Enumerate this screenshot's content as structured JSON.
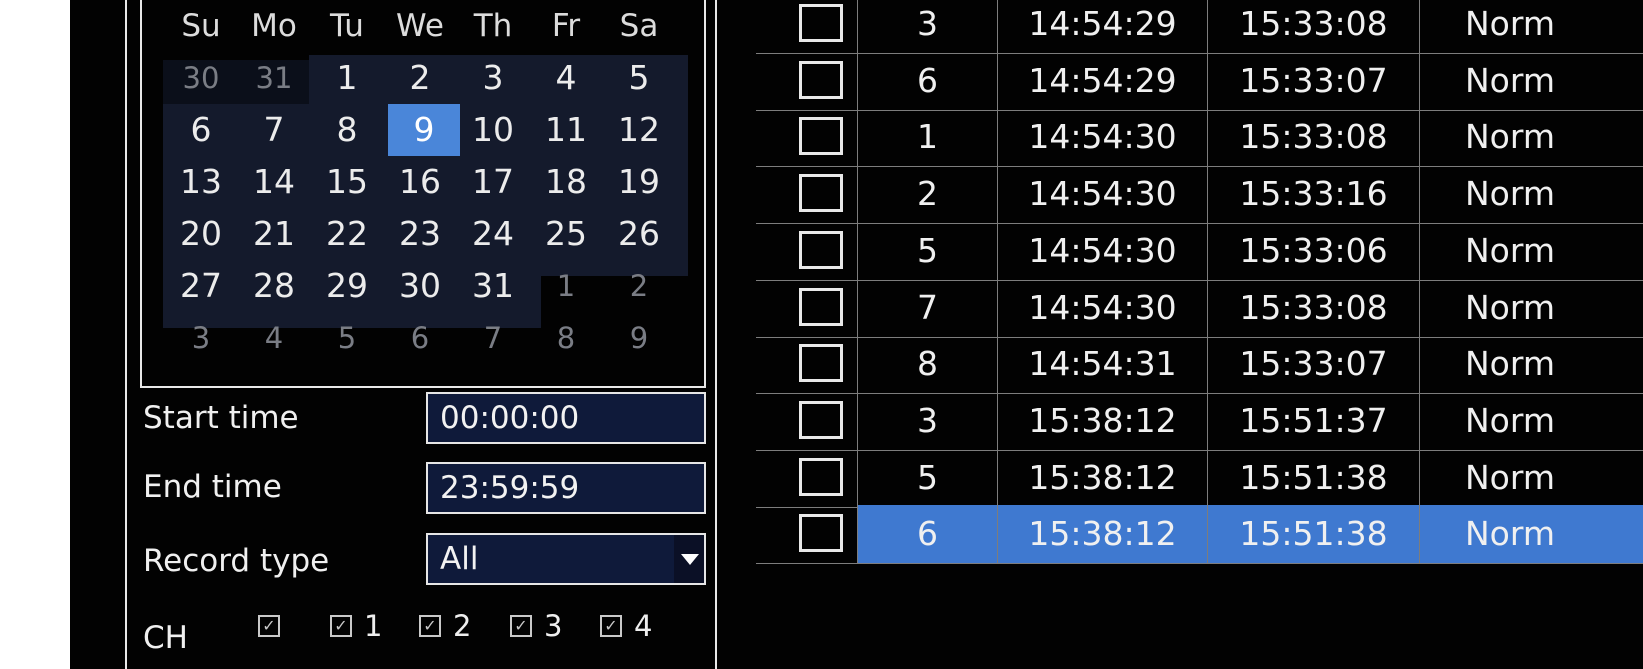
{
  "calendar": {
    "weekdays": [
      "Su",
      "Mo",
      "Tu",
      "We",
      "Th",
      "Fr",
      "Sa"
    ],
    "weeks": [
      [
        {
          "d": "30",
          "m": true
        },
        {
          "d": "31",
          "m": true
        },
        {
          "d": "1"
        },
        {
          "d": "2"
        },
        {
          "d": "3"
        },
        {
          "d": "4"
        },
        {
          "d": "5"
        }
      ],
      [
        {
          "d": "6"
        },
        {
          "d": "7"
        },
        {
          "d": "8"
        },
        {
          "d": "9",
          "sel": true
        },
        {
          "d": "10"
        },
        {
          "d": "11"
        },
        {
          "d": "12"
        }
      ],
      [
        {
          "d": "13"
        },
        {
          "d": "14"
        },
        {
          "d": "15"
        },
        {
          "d": "16"
        },
        {
          "d": "17"
        },
        {
          "d": "18"
        },
        {
          "d": "19"
        }
      ],
      [
        {
          "d": "20"
        },
        {
          "d": "21"
        },
        {
          "d": "22"
        },
        {
          "d": "23"
        },
        {
          "d": "24"
        },
        {
          "d": "25"
        },
        {
          "d": "26"
        }
      ],
      [
        {
          "d": "27"
        },
        {
          "d": "28"
        },
        {
          "d": "29"
        },
        {
          "d": "30"
        },
        {
          "d": "31"
        },
        {
          "d": "1",
          "m": true
        },
        {
          "d": "2",
          "m": true
        }
      ],
      [
        {
          "d": "3",
          "m": true
        },
        {
          "d": "4",
          "m": true
        },
        {
          "d": "5",
          "m": true
        },
        {
          "d": "6",
          "m": true
        },
        {
          "d": "7",
          "m": true
        },
        {
          "d": "8",
          "m": true
        },
        {
          "d": "9",
          "m": true
        }
      ]
    ],
    "selected_day": "9"
  },
  "search": {
    "start_time_label": "Start time",
    "start_time_value": "00:00:00",
    "end_time_label": "End time",
    "end_time_value": "23:59:59",
    "record_type_label": "Record type",
    "record_type_value": "All",
    "ch_label": "CH",
    "channels": [
      {
        "num": "",
        "checked": true
      },
      {
        "num": "1",
        "checked": true
      },
      {
        "num": "2",
        "checked": true
      },
      {
        "num": "3",
        "checked": true
      },
      {
        "num": "4",
        "checked": true
      }
    ]
  },
  "records": [
    {
      "ch": "3",
      "start": "14:54:29",
      "end": "15:33:08",
      "type": "Norm",
      "checked": false,
      "selected": false
    },
    {
      "ch": "6",
      "start": "14:54:29",
      "end": "15:33:07",
      "type": "Norm",
      "checked": false,
      "selected": false
    },
    {
      "ch": "1",
      "start": "14:54:30",
      "end": "15:33:08",
      "type": "Norm",
      "checked": false,
      "selected": false
    },
    {
      "ch": "2",
      "start": "14:54:30",
      "end": "15:33:16",
      "type": "Norm",
      "checked": false,
      "selected": false
    },
    {
      "ch": "5",
      "start": "14:54:30",
      "end": "15:33:06",
      "type": "Norm",
      "checked": false,
      "selected": false
    },
    {
      "ch": "7",
      "start": "14:54:30",
      "end": "15:33:08",
      "type": "Norm",
      "checked": false,
      "selected": false
    },
    {
      "ch": "8",
      "start": "14:54:31",
      "end": "15:33:07",
      "type": "Norm",
      "checked": false,
      "selected": false
    },
    {
      "ch": "3",
      "start": "15:38:12",
      "end": "15:51:37",
      "type": "Norm",
      "checked": false,
      "selected": false
    },
    {
      "ch": "5",
      "start": "15:38:12",
      "end": "15:51:38",
      "type": "Norm",
      "checked": false,
      "selected": false
    },
    {
      "ch": "6",
      "start": "15:38:12",
      "end": "15:51:38",
      "type": "Norm",
      "checked": false,
      "selected": true
    }
  ],
  "colors": {
    "background": "#020202",
    "selection": "#4a86d9",
    "field_bg": "#0f1a3a",
    "border": "#e8e8e8"
  }
}
